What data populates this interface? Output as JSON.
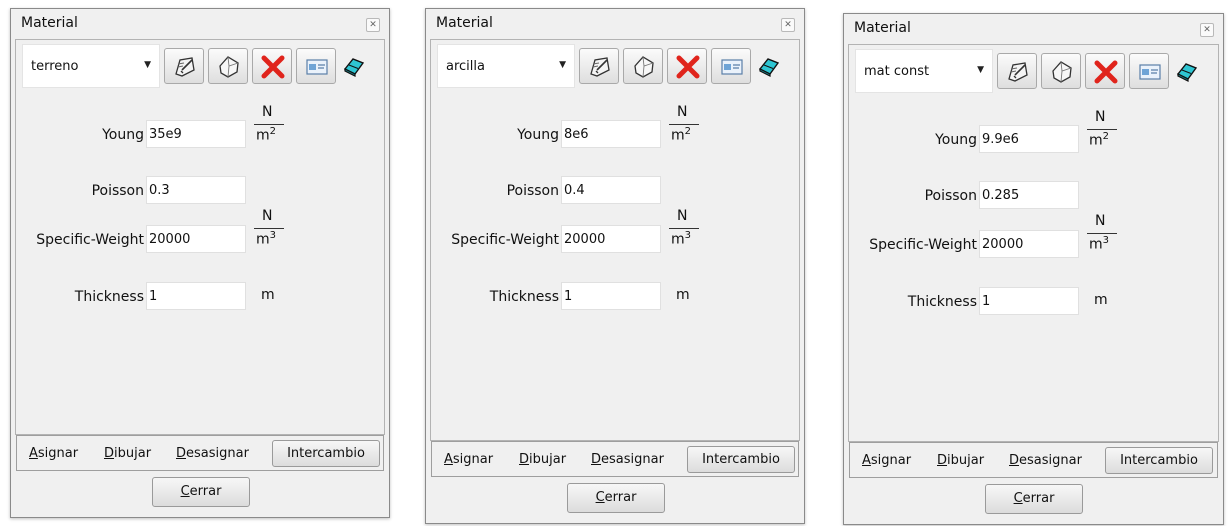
{
  "panels": [
    {
      "title": "Material",
      "material_select": "terreno",
      "fields": {
        "young": {
          "label": "Young",
          "value": "35e9",
          "unit_num": "N",
          "unit_den": "m",
          "unit_exp": "2"
        },
        "poisson": {
          "label": "Poisson",
          "value": "0.3"
        },
        "specific_weight": {
          "label": "Specific-Weight",
          "value": "20000",
          "unit_num": "N",
          "unit_den": "m",
          "unit_exp": "3"
        },
        "thickness": {
          "label": "Thickness",
          "value": "1",
          "unit": "m"
        }
      },
      "actions": {
        "assign": {
          "accel": "A",
          "rest": "signar"
        },
        "draw": {
          "accel": "D",
          "rest": "ibujar"
        },
        "unassign": {
          "accel": "D",
          "rest": "esasignar"
        },
        "exchange": "Intercambio"
      },
      "close": {
        "accel": "C",
        "rest": "errar"
      }
    },
    {
      "title": "Material",
      "material_select": "arcilla",
      "fields": {
        "young": {
          "label": "Young",
          "value": "8e6",
          "unit_num": "N",
          "unit_den": "m",
          "unit_exp": "2"
        },
        "poisson": {
          "label": "Poisson",
          "value": "0.4"
        },
        "specific_weight": {
          "label": "Specific-Weight",
          "value": "20000",
          "unit_num": "N",
          "unit_den": "m",
          "unit_exp": "3"
        },
        "thickness": {
          "label": "Thickness",
          "value": "1",
          "unit": "m"
        }
      },
      "actions": {
        "assign": {
          "accel": "A",
          "rest": "signar"
        },
        "draw": {
          "accel": "D",
          "rest": "ibujar"
        },
        "unassign": {
          "accel": "D",
          "rest": "esasignar"
        },
        "exchange": "Intercambio"
      },
      "close": {
        "accel": "C",
        "rest": "errar"
      }
    },
    {
      "title": "Material",
      "material_select": "mat const",
      "fields": {
        "young": {
          "label": "Young",
          "value": "9.9e6",
          "unit_num": "N",
          "unit_den": "m",
          "unit_exp": "2"
        },
        "poisson": {
          "label": "Poisson",
          "value": "0.285"
        },
        "specific_weight": {
          "label": "Specific-Weight",
          "value": "20000",
          "unit_num": "N",
          "unit_den": "m",
          "unit_exp": "3"
        },
        "thickness": {
          "label": "Thickness",
          "value": "1",
          "unit": "m"
        }
      },
      "actions": {
        "assign": {
          "accel": "A",
          "rest": "signar"
        },
        "draw": {
          "accel": "D",
          "rest": "ibujar"
        },
        "unassign": {
          "accel": "D",
          "rest": "esasignar"
        },
        "exchange": "Intercambio"
      },
      "close": {
        "accel": "C",
        "rest": "errar"
      }
    }
  ],
  "icons": {
    "edit": "edit-material-icon",
    "new": "new-material-icon",
    "delete": "delete-material-icon",
    "properties": "material-properties-icon",
    "eraser": "eraser-icon"
  },
  "colors": {
    "window_bg": "#f0f0f0",
    "delete_red": "#e0241c",
    "eraser_cyan": "#2ec6d3"
  }
}
